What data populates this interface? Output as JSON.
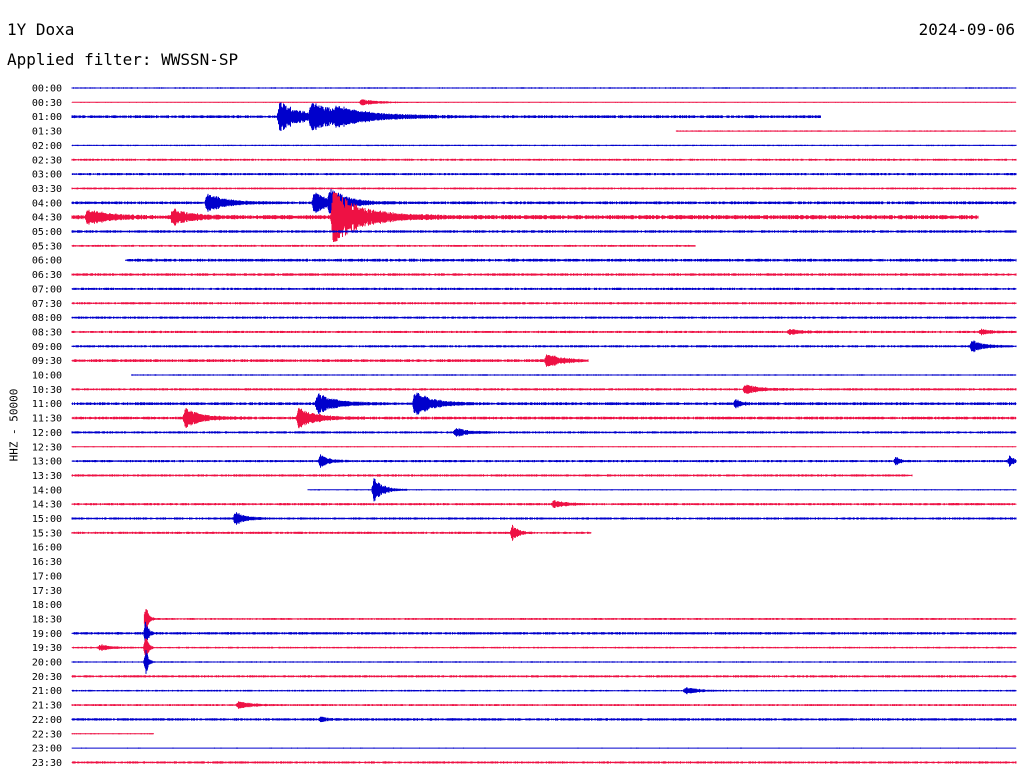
{
  "header": {
    "station": "1Y Doxa",
    "date": "2024-09-06",
    "filter": "Applied filter: WWSSN-SP",
    "channel_label": "HHZ - 50000"
  },
  "colors": {
    "blue": "#0000cc",
    "red": "#ee1144"
  },
  "chart_data": {
    "type": "line",
    "title": "1Y Doxa 2024-09-06",
    "ylabel": "HHZ - 50000",
    "x_unit": "minutes within 30-min row",
    "rows": [
      {
        "label": "00:00",
        "color": "blue",
        "s": 0,
        "e": 30,
        "n": 0.5,
        "ev": []
      },
      {
        "label": "00:30",
        "color": "red",
        "s": 0,
        "e": 30,
        "n": 0.4,
        "ev": [
          [
            9.2,
            2.5,
            1.4
          ]
        ]
      },
      {
        "label": "01:00",
        "color": "blue",
        "s": 0,
        "e": 23.8,
        "n": 1.0,
        "ev": [
          [
            6.6,
            13,
            1.8
          ],
          [
            7.6,
            10,
            3
          ],
          [
            8.4,
            5,
            3
          ]
        ]
      },
      {
        "label": "01:30",
        "color": "red",
        "s": 19.2,
        "e": 30,
        "n": 0.5,
        "ev": []
      },
      {
        "label": "02:00",
        "color": "blue",
        "s": 0,
        "e": 30,
        "n": 0.5,
        "ev": []
      },
      {
        "label": "02:30",
        "color": "red",
        "s": 0,
        "e": 30,
        "n": 0.7,
        "ev": []
      },
      {
        "label": "03:00",
        "color": "blue",
        "s": 0,
        "e": 30,
        "n": 0.8,
        "ev": []
      },
      {
        "label": "03:30",
        "color": "red",
        "s": 0,
        "e": 30,
        "n": 0.7,
        "ev": []
      },
      {
        "label": "04:00",
        "color": "blue",
        "s": 0,
        "e": 30,
        "n": 1.0,
        "ev": [
          [
            4.3,
            8,
            1.5
          ],
          [
            7.7,
            9,
            1.2
          ],
          [
            8.2,
            11,
            1.5
          ]
        ]
      },
      {
        "label": "04:30",
        "color": "red",
        "s": 0,
        "e": 28.8,
        "n": 1.5,
        "ev": [
          [
            0.5,
            7,
            1.6
          ],
          [
            3.2,
            7,
            1.5
          ],
          [
            8.3,
            22,
            2.5
          ]
        ]
      },
      {
        "label": "05:00",
        "color": "blue",
        "s": 0,
        "e": 30,
        "n": 0.9,
        "ev": []
      },
      {
        "label": "05:30",
        "color": "red",
        "s": 0,
        "e": 19.8,
        "n": 0.7,
        "ev": []
      },
      {
        "label": "06:00",
        "color": "blue",
        "s": 1.7,
        "e": 30,
        "n": 1.0,
        "ev": []
      },
      {
        "label": "06:30",
        "color": "red",
        "s": 0,
        "e": 30,
        "n": 0.9,
        "ev": []
      },
      {
        "label": "07:00",
        "color": "blue",
        "s": 0,
        "e": 30,
        "n": 0.8,
        "ev": []
      },
      {
        "label": "07:30",
        "color": "red",
        "s": 0,
        "e": 30,
        "n": 0.8,
        "ev": []
      },
      {
        "label": "08:00",
        "color": "blue",
        "s": 0,
        "e": 30,
        "n": 0.8,
        "ev": []
      },
      {
        "label": "08:30",
        "color": "red",
        "s": 0,
        "e": 30,
        "n": 0.8,
        "ev": [
          [
            22.8,
            2,
            1.2
          ],
          [
            28.9,
            2,
            0.8
          ]
        ]
      },
      {
        "label": "09:00",
        "color": "blue",
        "s": 0,
        "e": 30,
        "n": 0.8,
        "ev": [
          [
            28.6,
            5,
            1
          ]
        ]
      },
      {
        "label": "09:30",
        "color": "red",
        "s": 0,
        "e": 16.4,
        "n": 1.0,
        "ev": [
          [
            15.1,
            6,
            1.2
          ]
        ]
      },
      {
        "label": "10:00",
        "color": "blue",
        "s": 1.9,
        "e": 30,
        "n": 0.5,
        "ev": []
      },
      {
        "label": "10:30",
        "color": "red",
        "s": 0,
        "e": 30,
        "n": 0.8,
        "ev": [
          [
            21.4,
            4,
            1.2
          ]
        ]
      },
      {
        "label": "11:00",
        "color": "blue",
        "s": 0,
        "e": 30,
        "n": 1.0,
        "ev": [
          [
            7.8,
            9,
            1.5
          ],
          [
            10.9,
            11,
            1.5
          ],
          [
            21.1,
            4,
            0.4
          ]
        ]
      },
      {
        "label": "11:30",
        "color": "red",
        "s": 0,
        "e": 30,
        "n": 1.0,
        "ev": [
          [
            3.6,
            8,
            1.4
          ],
          [
            7.2,
            9,
            1.4
          ]
        ]
      },
      {
        "label": "12:00",
        "color": "blue",
        "s": 0,
        "e": 30,
        "n": 0.8,
        "ev": [
          [
            12.2,
            4,
            1
          ]
        ]
      },
      {
        "label": "12:30",
        "color": "red",
        "s": 0,
        "e": 30,
        "n": 0.5,
        "ev": []
      },
      {
        "label": "13:00",
        "color": "blue",
        "s": 0,
        "e": 30,
        "n": 0.8,
        "ev": [
          [
            7.9,
            6,
            0.6
          ],
          [
            26.2,
            4,
            0.3
          ],
          [
            29.8,
            5,
            0.3
          ]
        ]
      },
      {
        "label": "13:30",
        "color": "red",
        "s": 0,
        "e": 26.7,
        "n": 0.8,
        "ev": []
      },
      {
        "label": "14:00",
        "color": "blue",
        "s": 7.5,
        "e": 30,
        "n": 0.5,
        "ev": [
          [
            9.6,
            10,
            0.8
          ]
        ]
      },
      {
        "label": "14:30",
        "color": "red",
        "s": 0,
        "e": 30,
        "n": 0.8,
        "ev": [
          [
            15.3,
            3,
            1
          ]
        ]
      },
      {
        "label": "15:00",
        "color": "blue",
        "s": 0,
        "e": 30,
        "n": 0.8,
        "ev": [
          [
            5.2,
            6,
            0.8
          ]
        ]
      },
      {
        "label": "15:30",
        "color": "red",
        "s": 0,
        "e": 16.5,
        "n": 0.8,
        "ev": [
          [
            14.0,
            7,
            0.5
          ]
        ]
      },
      {
        "label": "16:00",
        "color": "blue",
        "s": 0,
        "e": 0,
        "n": 0,
        "ev": []
      },
      {
        "label": "16:30",
        "color": "red",
        "s": 0,
        "e": 0,
        "n": 0,
        "ev": []
      },
      {
        "label": "17:00",
        "color": "blue",
        "s": 0,
        "e": 0,
        "n": 0,
        "ev": []
      },
      {
        "label": "17:30",
        "color": "red",
        "s": 0,
        "e": 0,
        "n": 0,
        "ev": []
      },
      {
        "label": "18:00",
        "color": "blue",
        "s": 0,
        "e": 0,
        "n": 0,
        "ev": []
      },
      {
        "label": "18:30",
        "color": "red",
        "s": 2.3,
        "e": 30,
        "n": 0.7,
        "ev": [
          [
            2.35,
            14,
            0.2
          ]
        ]
      },
      {
        "label": "19:00",
        "color": "blue",
        "s": 0,
        "e": 30,
        "n": 0.9,
        "ev": [
          [
            2.35,
            12,
            0.2
          ]
        ]
      },
      {
        "label": "19:30",
        "color": "red",
        "s": 0,
        "e": 30,
        "n": 0.6,
        "ev": [
          [
            0.9,
            3,
            0.8
          ],
          [
            2.35,
            13,
            0.2
          ]
        ]
      },
      {
        "label": "20:00",
        "color": "blue",
        "s": 0,
        "e": 30,
        "n": 0.5,
        "ev": [
          [
            2.35,
            12,
            0.2
          ]
        ]
      },
      {
        "label": "20:30",
        "color": "red",
        "s": 0,
        "e": 30,
        "n": 0.8,
        "ev": []
      },
      {
        "label": "21:00",
        "color": "blue",
        "s": 0,
        "e": 30,
        "n": 0.6,
        "ev": [
          [
            19.5,
            3,
            1
          ]
        ]
      },
      {
        "label": "21:30",
        "color": "red",
        "s": 0,
        "e": 30,
        "n": 0.7,
        "ev": [
          [
            5.3,
            3,
            1
          ]
        ]
      },
      {
        "label": "22:00",
        "color": "blue",
        "s": 0,
        "e": 30,
        "n": 0.9,
        "ev": [
          [
            7.9,
            2,
            0.6
          ]
        ]
      },
      {
        "label": "22:30",
        "color": "red",
        "s": 0,
        "e": 2.6,
        "n": 0.5,
        "ev": []
      },
      {
        "label": "23:00",
        "color": "blue",
        "s": 0,
        "e": 30,
        "n": 0.4,
        "ev": []
      },
      {
        "label": "23:30",
        "color": "red",
        "s": 0,
        "e": 30,
        "n": 0.8,
        "ev": []
      }
    ]
  }
}
